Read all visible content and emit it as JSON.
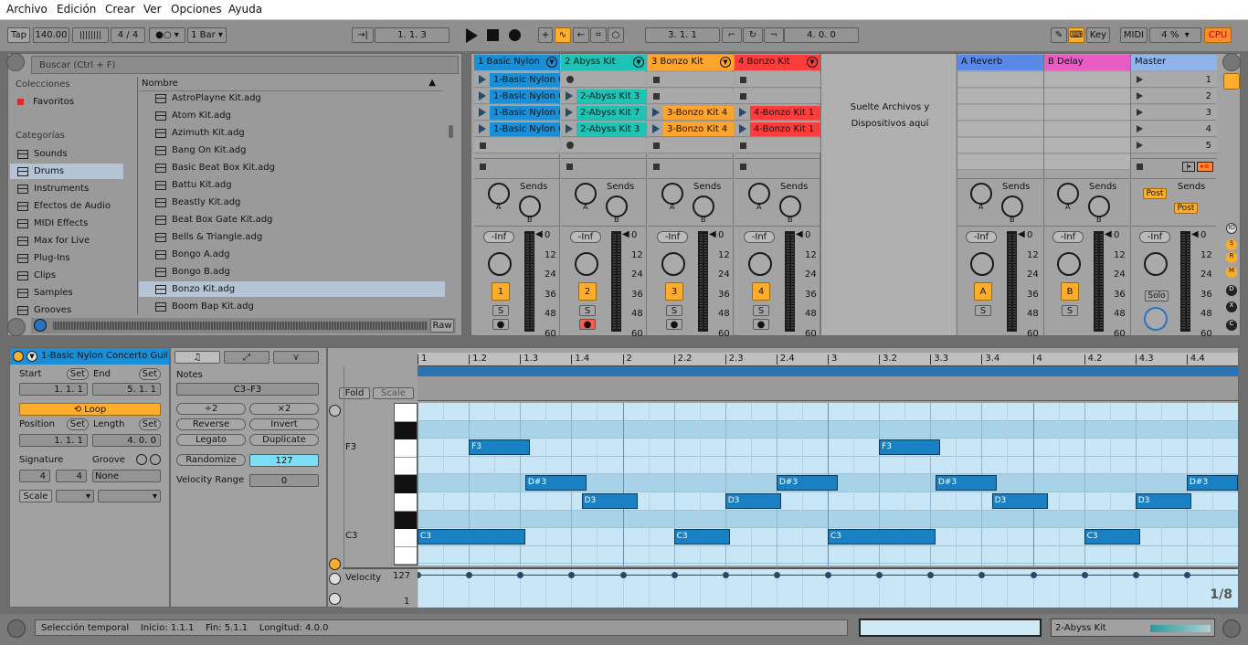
{
  "menu": [
    "Archivo",
    "Edición",
    "Crear",
    "Ver",
    "Opciones",
    "Ayuda"
  ],
  "transport": {
    "tap": "Tap",
    "tempo": "140.00",
    "sig": "4 / 4",
    "quant": "1 Bar",
    "arr_pos": "1.   1.   3",
    "loop_start": "3.   1.   1",
    "loop_len": "4.   0.   0",
    "key": "Key",
    "midi": "MIDI",
    "cpu_pct": "4 %",
    "cpu": "CPU"
  },
  "browser": {
    "search_placeholder": "Buscar (Ctrl + F)",
    "collections_header": "Colecciones",
    "favorites": "Favoritos",
    "categories_header": "Categorías",
    "categories": [
      "Sounds",
      "Drums",
      "Instruments",
      "Efectos de Audio",
      "MIDI Effects",
      "Max for Live",
      "Plug-Ins",
      "Clips",
      "Samples",
      "Grooves"
    ],
    "name_header": "Nombre",
    "files": [
      "AstroPlayne Kit.adg",
      "Atom Kit.adg",
      "Azimuth Kit.adg",
      "Bang On Kit.adg",
      "Basic Beat Box Kit.adg",
      "Battu Kit.adg",
      "Beastly Kit.adg",
      "Beat Box Gate Kit.adg",
      "Bells & Triangle.adg",
      "Bongo A.adg",
      "Bongo B.adg",
      "Bonzo Kit.adg",
      "Boom Bap Kit.adg"
    ],
    "raw": "Raw"
  },
  "tracks": [
    {
      "name": "1 Basic Nylon",
      "color": "#1a8fd6",
      "clips": [
        "1-Basic Nylon C",
        "1-Basic Nylon C",
        "1-Basic Nylon C",
        "1-Basic Nylon C"
      ],
      "num": "1"
    },
    {
      "name": "2 Abyss Kit",
      "color": "#1fc3b5",
      "clips": [
        "",
        "2-Abyss Kit 3",
        "2-Abyss Kit 7",
        "2-Abyss Kit 3"
      ],
      "num": "2"
    },
    {
      "name": "3 Bonzo Kit",
      "color": "#ffa42c",
      "clips": [
        "",
        "",
        "3-Bonzo Kit 4",
        "3-Bonzo Kit 4"
      ],
      "num": "3"
    },
    {
      "name": "4 Bonzo Kit",
      "color": "#ff3c3c",
      "clips": [
        "",
        "",
        "4-Bonzo Kit 1",
        "4-Bonzo Kit 1"
      ],
      "num": "4"
    }
  ],
  "drop": "Suelte Archivos y Dispositivos aquí",
  "returns": [
    {
      "name": "A Reverb",
      "letter": "A"
    },
    {
      "name": "B Delay",
      "letter": "B"
    }
  ],
  "master": {
    "name": "Master",
    "scenes": [
      "1",
      "2",
      "3",
      "4",
      "5"
    ],
    "post": "Post",
    "solo": "Solo"
  },
  "mixer": {
    "sends": "Sends",
    "inf": "-Inf",
    "db": [
      "0",
      "12",
      "24",
      "36",
      "48",
      "60"
    ],
    "s": "S",
    "knob_a": "A",
    "knob_b": "B"
  },
  "clip": {
    "title": "1-Basic Nylon Concerto Guit",
    "start_label": "Start",
    "end_label": "End",
    "set": "Set",
    "start": "1.   1.   1",
    "end": "5.   1.   1",
    "loop": "Loop",
    "position_label": "Position",
    "length_label": "Length",
    "position": "1.   1.   1",
    "length": "4.   0.   0",
    "signature_label": "Signature",
    "groove_label": "Groove",
    "sig_num": "4",
    "sig_den": "4",
    "groove": "None",
    "scale": "Scale"
  },
  "notes": {
    "header": "Notes",
    "range": "C3–F3",
    "div2": "÷2",
    "mul2": "×2",
    "reverse": "Reverse",
    "invert": "Invert",
    "legato": "Legato",
    "duplicate": "Duplicate",
    "randomize": "Randomize",
    "rand_val": "127",
    "vel_range_label": "Velocity Range",
    "vel_range": "0"
  },
  "editor": {
    "fold": "Fold",
    "scale": "Scale",
    "f3": "F3",
    "c3": "C3",
    "bars": [
      "1",
      "1.2",
      "1.3",
      "1.4",
      "2",
      "2.2",
      "2.3",
      "2.4",
      "3",
      "3.2",
      "3.3",
      "3.4",
      "4",
      "4.2",
      "4.3",
      "4.4"
    ],
    "velocity": "Velocity",
    "vel_max": "127",
    "vel_min": "1",
    "grid": "1/8"
  },
  "midi_notes": [
    {
      "p": "F3",
      "s": 1.5,
      "l": 0.6
    },
    {
      "p": "D#3",
      "s": 2.05,
      "l": 0.6
    },
    {
      "p": "D3",
      "s": 2.6,
      "l": 0.55
    },
    {
      "p": "C3",
      "s": 1.0,
      "l": 1.05
    },
    {
      "p": "C3",
      "s": 3.5,
      "l": 0.55
    },
    {
      "p": "D3",
      "s": 4.0,
      "l": 0.55
    },
    {
      "p": "D#3",
      "s": 4.5,
      "l": 0.6
    },
    {
      "p": "F3",
      "s": 5.5,
      "l": 0.6
    },
    {
      "p": "D#3",
      "s": 6.05,
      "l": 0.6
    },
    {
      "p": "D3",
      "s": 6.6,
      "l": 0.55
    },
    {
      "p": "C3",
      "s": 5.0,
      "l": 1.05
    },
    {
      "p": "C3",
      "s": 7.5,
      "l": 0.55
    },
    {
      "p": "D3",
      "s": 8.0,
      "l": 0.55
    },
    {
      "p": "D#3",
      "s": 8.5,
      "l": 0.5
    }
  ],
  "status": {
    "text": "Selección temporal",
    "start": "Inicio: 1.1.1",
    "end": "Fin: 5.1.1",
    "length": "Longitud: 4.0.0",
    "track": "2-Abyss Kit"
  }
}
